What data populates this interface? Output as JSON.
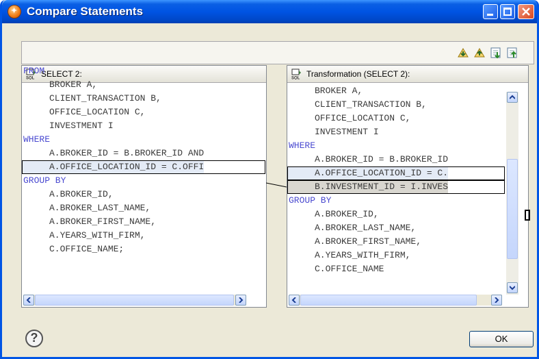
{
  "window": {
    "title": "Compare Statements"
  },
  "left_pane": {
    "title": "SELECT 2:",
    "lines": [
      {
        "text": "FROM",
        "indent": 0,
        "kw": true
      },
      {
        "text": "BROKER A,",
        "indent": 1
      },
      {
        "text": "CLIENT_TRANSACTION B,",
        "indent": 1
      },
      {
        "text": "OFFICE_LOCATION C,",
        "indent": 1
      },
      {
        "text": "INVESTMENT I",
        "indent": 1
      },
      {
        "text": "WHERE",
        "indent": 0,
        "kw": true
      },
      {
        "text": "A.BROKER_ID = B.BROKER_ID AND",
        "indent": 1
      },
      {
        "text": "A.OFFICE_LOCATION_ID = C.OFFI",
        "indent": 1,
        "highlight": true
      },
      {
        "text": "GROUP BY",
        "indent": 0,
        "kw": true
      },
      {
        "text": "A.BROKER_ID,",
        "indent": 1
      },
      {
        "text": "A.BROKER_LAST_NAME,",
        "indent": 1
      },
      {
        "text": "A.BROKER_FIRST_NAME,",
        "indent": 1
      },
      {
        "text": "A.YEARS_WITH_FIRM,",
        "indent": 1
      },
      {
        "text": "C.OFFICE_NAME;",
        "indent": 1
      }
    ]
  },
  "right_pane": {
    "title": "Transformation (SELECT 2):",
    "lines": [
      {
        "text": "BROKER A,",
        "indent": 1
      },
      {
        "text": "CLIENT_TRANSACTION B,",
        "indent": 1
      },
      {
        "text": "OFFICE_LOCATION C,",
        "indent": 1
      },
      {
        "text": "INVESTMENT I",
        "indent": 1
      },
      {
        "text": "WHERE",
        "indent": 0,
        "kw": true
      },
      {
        "text": "A.BROKER_ID = B.BROKER_ID",
        "indent": 1
      },
      {
        "text": "A.OFFICE_LOCATION_ID = C.",
        "indent": 1,
        "highlight": true
      },
      {
        "text": "B.INVESTMENT_ID = I.INVES",
        "indent": 1,
        "highlight": true,
        "added": true
      },
      {
        "text": "GROUP BY",
        "indent": 0,
        "kw": true
      },
      {
        "text": "A.BROKER_ID,",
        "indent": 1
      },
      {
        "text": "A.BROKER_LAST_NAME,",
        "indent": 1
      },
      {
        "text": "A.BROKER_FIRST_NAME,",
        "indent": 1
      },
      {
        "text": "A.YEARS_WITH_FIRM,",
        "indent": 1
      },
      {
        "text": "C.OFFICE_NAME",
        "indent": 1
      }
    ]
  },
  "toolbar_icons": [
    "next-difference-icon",
    "previous-difference-icon",
    "next-change-icon",
    "previous-change-icon"
  ],
  "buttons": {
    "ok": "OK",
    "help": "?"
  }
}
